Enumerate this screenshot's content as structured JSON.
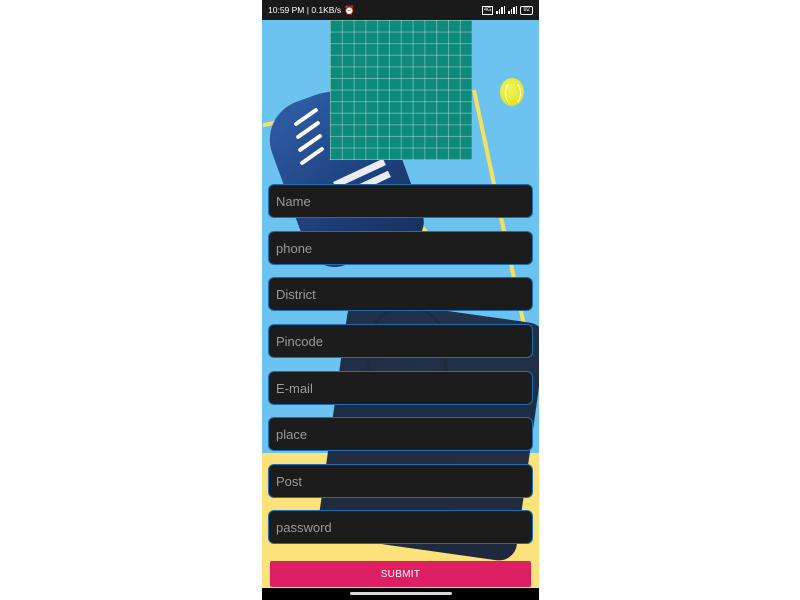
{
  "status_bar": {
    "time_speed": "10:59 PM | 0.1KB/s",
    "network_tag": "4G",
    "battery": "92"
  },
  "form": {
    "fields": [
      {
        "name": "name-input",
        "placeholder": "Name"
      },
      {
        "name": "phone-input",
        "placeholder": "phone"
      },
      {
        "name": "district-input",
        "placeholder": "District"
      },
      {
        "name": "pincode-input",
        "placeholder": "Pincode"
      },
      {
        "name": "email-input",
        "placeholder": "E-mail"
      },
      {
        "name": "place-input",
        "placeholder": "place"
      },
      {
        "name": "post-input",
        "placeholder": "Post"
      },
      {
        "name": "password-input",
        "placeholder": "password"
      }
    ],
    "submit_label": "SUBMIT"
  },
  "colors": {
    "accent": "#dd1e63",
    "field_border": "#1a6fb5",
    "field_bg": "#1c1c1c",
    "background_blue": "#6cc3ef",
    "background_yellow": "#fbe27a"
  }
}
